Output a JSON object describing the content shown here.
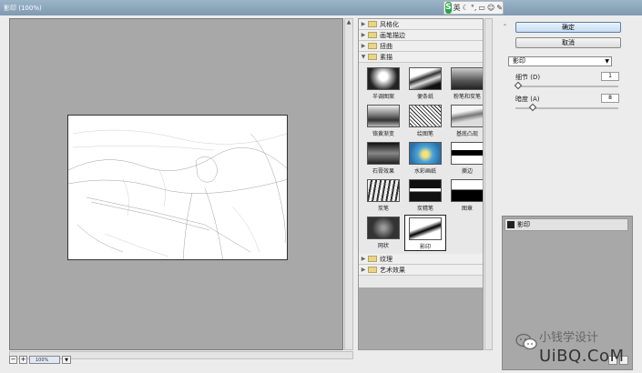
{
  "window": {
    "title": "影印 (100%)"
  },
  "ime": {
    "logo": "S",
    "mode": "英"
  },
  "preview": {
    "zoom": "100%"
  },
  "gallery": {
    "categories_top": [
      {
        "label": "风格化",
        "expanded": false
      },
      {
        "label": "画笔描边",
        "expanded": false
      },
      {
        "label": "扭曲",
        "expanded": false
      },
      {
        "label": "素描",
        "expanded": true
      }
    ],
    "thumbs": [
      {
        "label": "半调图案"
      },
      {
        "label": "便条纸"
      },
      {
        "label": "粉笔和炭笔"
      },
      {
        "label": "铬黄渐变"
      },
      {
        "label": "绘图笔"
      },
      {
        "label": "基底凸现"
      },
      {
        "label": "石膏效果"
      },
      {
        "label": "水彩画纸"
      },
      {
        "label": "撕边"
      },
      {
        "label": "炭笔"
      },
      {
        "label": "炭精笔"
      },
      {
        "label": "图章"
      },
      {
        "label": "网状"
      },
      {
        "label": "影印",
        "selected": true
      }
    ],
    "categories_bottom": [
      {
        "label": "纹理"
      },
      {
        "label": "艺术效果"
      }
    ]
  },
  "actions": {
    "ok": "确定",
    "cancel": "取消"
  },
  "filter_select": {
    "value": "影印"
  },
  "params": [
    {
      "label": "细节 (D)",
      "value": "1",
      "level": 0.0
    },
    {
      "label": "暗度 (A)",
      "value": "8",
      "level": 0.15
    }
  ],
  "layers": {
    "items": [
      {
        "label": "影印"
      }
    ]
  },
  "watermark": {
    "line1": "小钱学设计",
    "line2": "UiBQ.CoM"
  }
}
